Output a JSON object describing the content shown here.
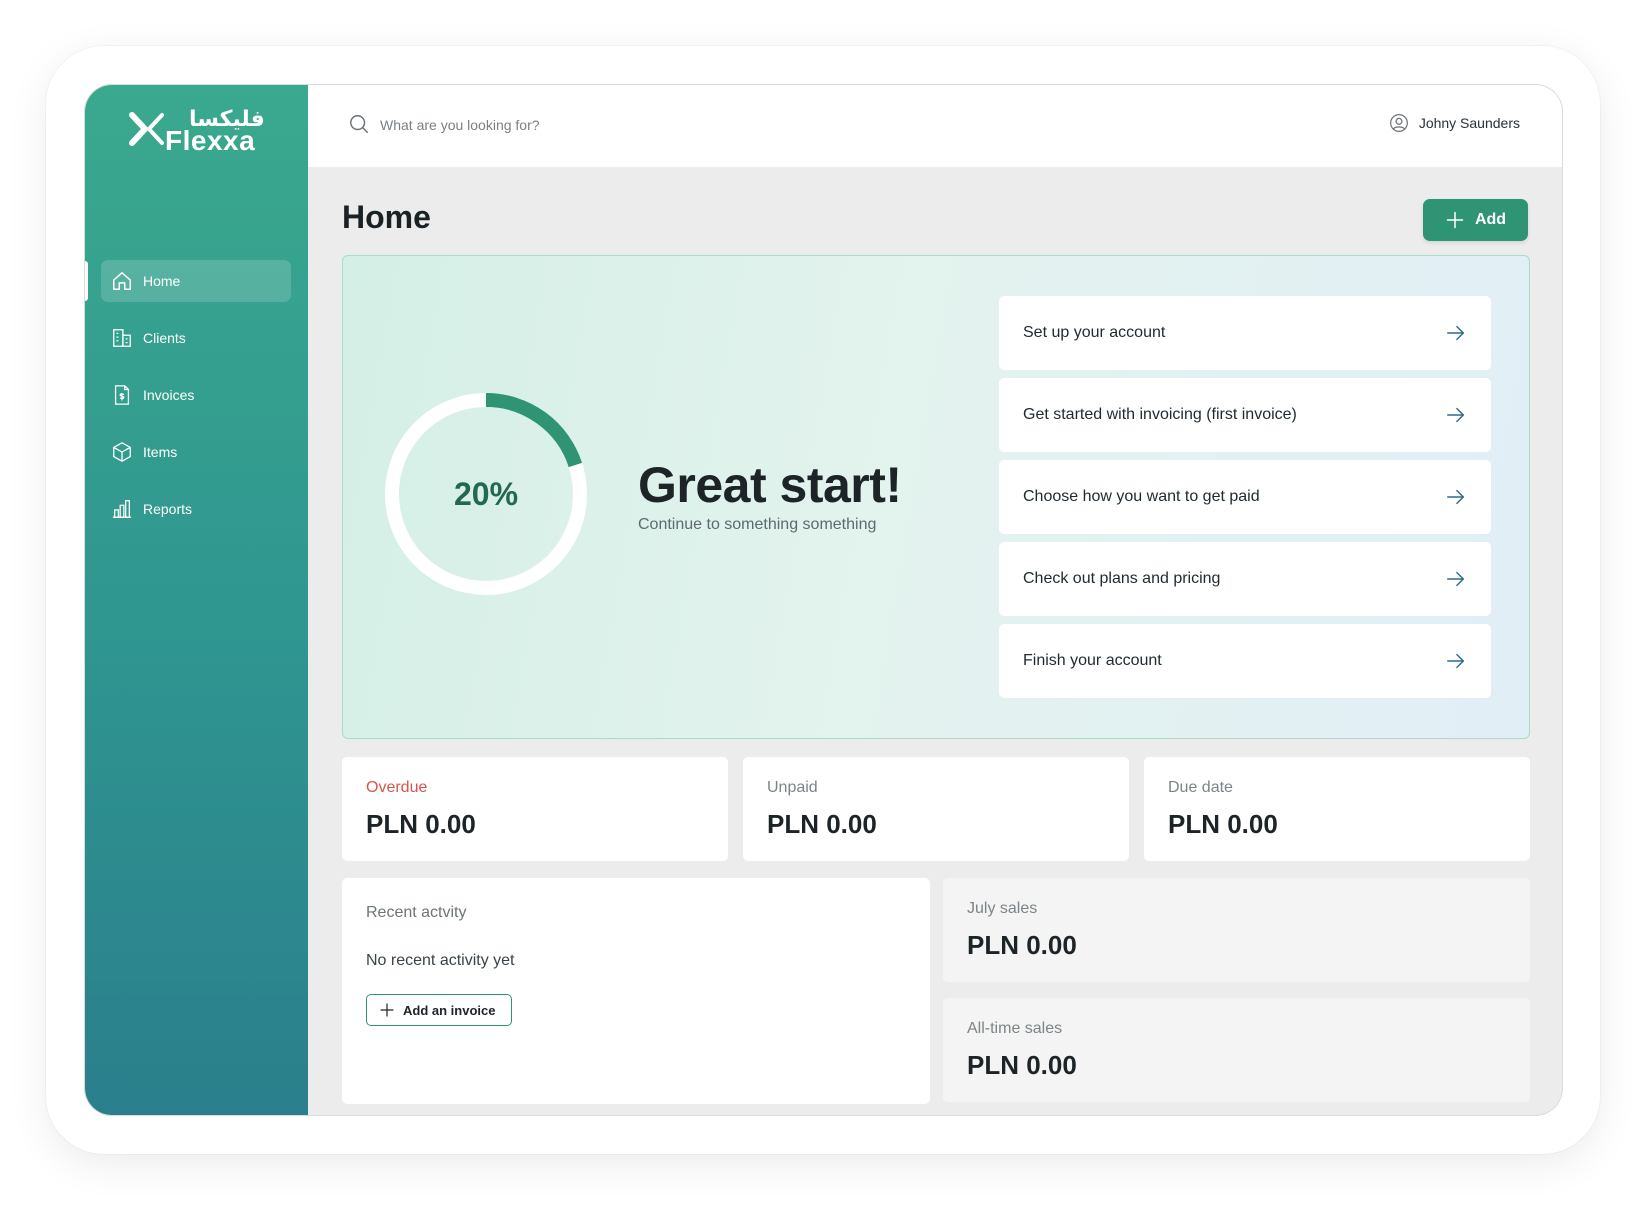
{
  "brand": {
    "arabic_name": "فليكسا",
    "name": "Flexxa",
    "color": "#3aa98e"
  },
  "sidebar": {
    "items": [
      {
        "label": "Home",
        "icon": "home-icon",
        "active": true
      },
      {
        "label": "Clients",
        "icon": "building-icon",
        "active": false
      },
      {
        "label": "Invoices",
        "icon": "invoice-icon",
        "active": false
      },
      {
        "label": "Items",
        "icon": "box-icon",
        "active": false
      },
      {
        "label": "Reports",
        "icon": "bar-chart-icon",
        "active": false
      }
    ]
  },
  "topbar": {
    "search_placeholder": "What are you looking for?",
    "user_name": "Johny Saunders"
  },
  "main": {
    "title": "Home",
    "add_label": "Add"
  },
  "hero": {
    "progress_percent": 20,
    "progress_label": "20%",
    "title": "Great start!",
    "subtitle": "Continue to something something",
    "tasks": [
      "Set up your account",
      "Get started with invoicing (first invoice)",
      "Choose how you want to get paid",
      "Check out plans and pricing",
      "Finish your account"
    ],
    "accent_color": "#2e9474"
  },
  "stats": [
    {
      "label": "Overdue",
      "value": "PLN 0.00",
      "status_color": "#d9534f"
    },
    {
      "label": "Unpaid",
      "value": "PLN 0.00"
    },
    {
      "label": "Due date",
      "value": "PLN 0.00"
    }
  ],
  "activity": {
    "title": "Recent actvity",
    "empty_text": "No recent activity yet",
    "add_invoice_label": "Add an invoice"
  },
  "sales": [
    {
      "label": "July sales",
      "value": "PLN 0.00"
    },
    {
      "label": "All-time sales",
      "value": "PLN 0.00"
    }
  ]
}
